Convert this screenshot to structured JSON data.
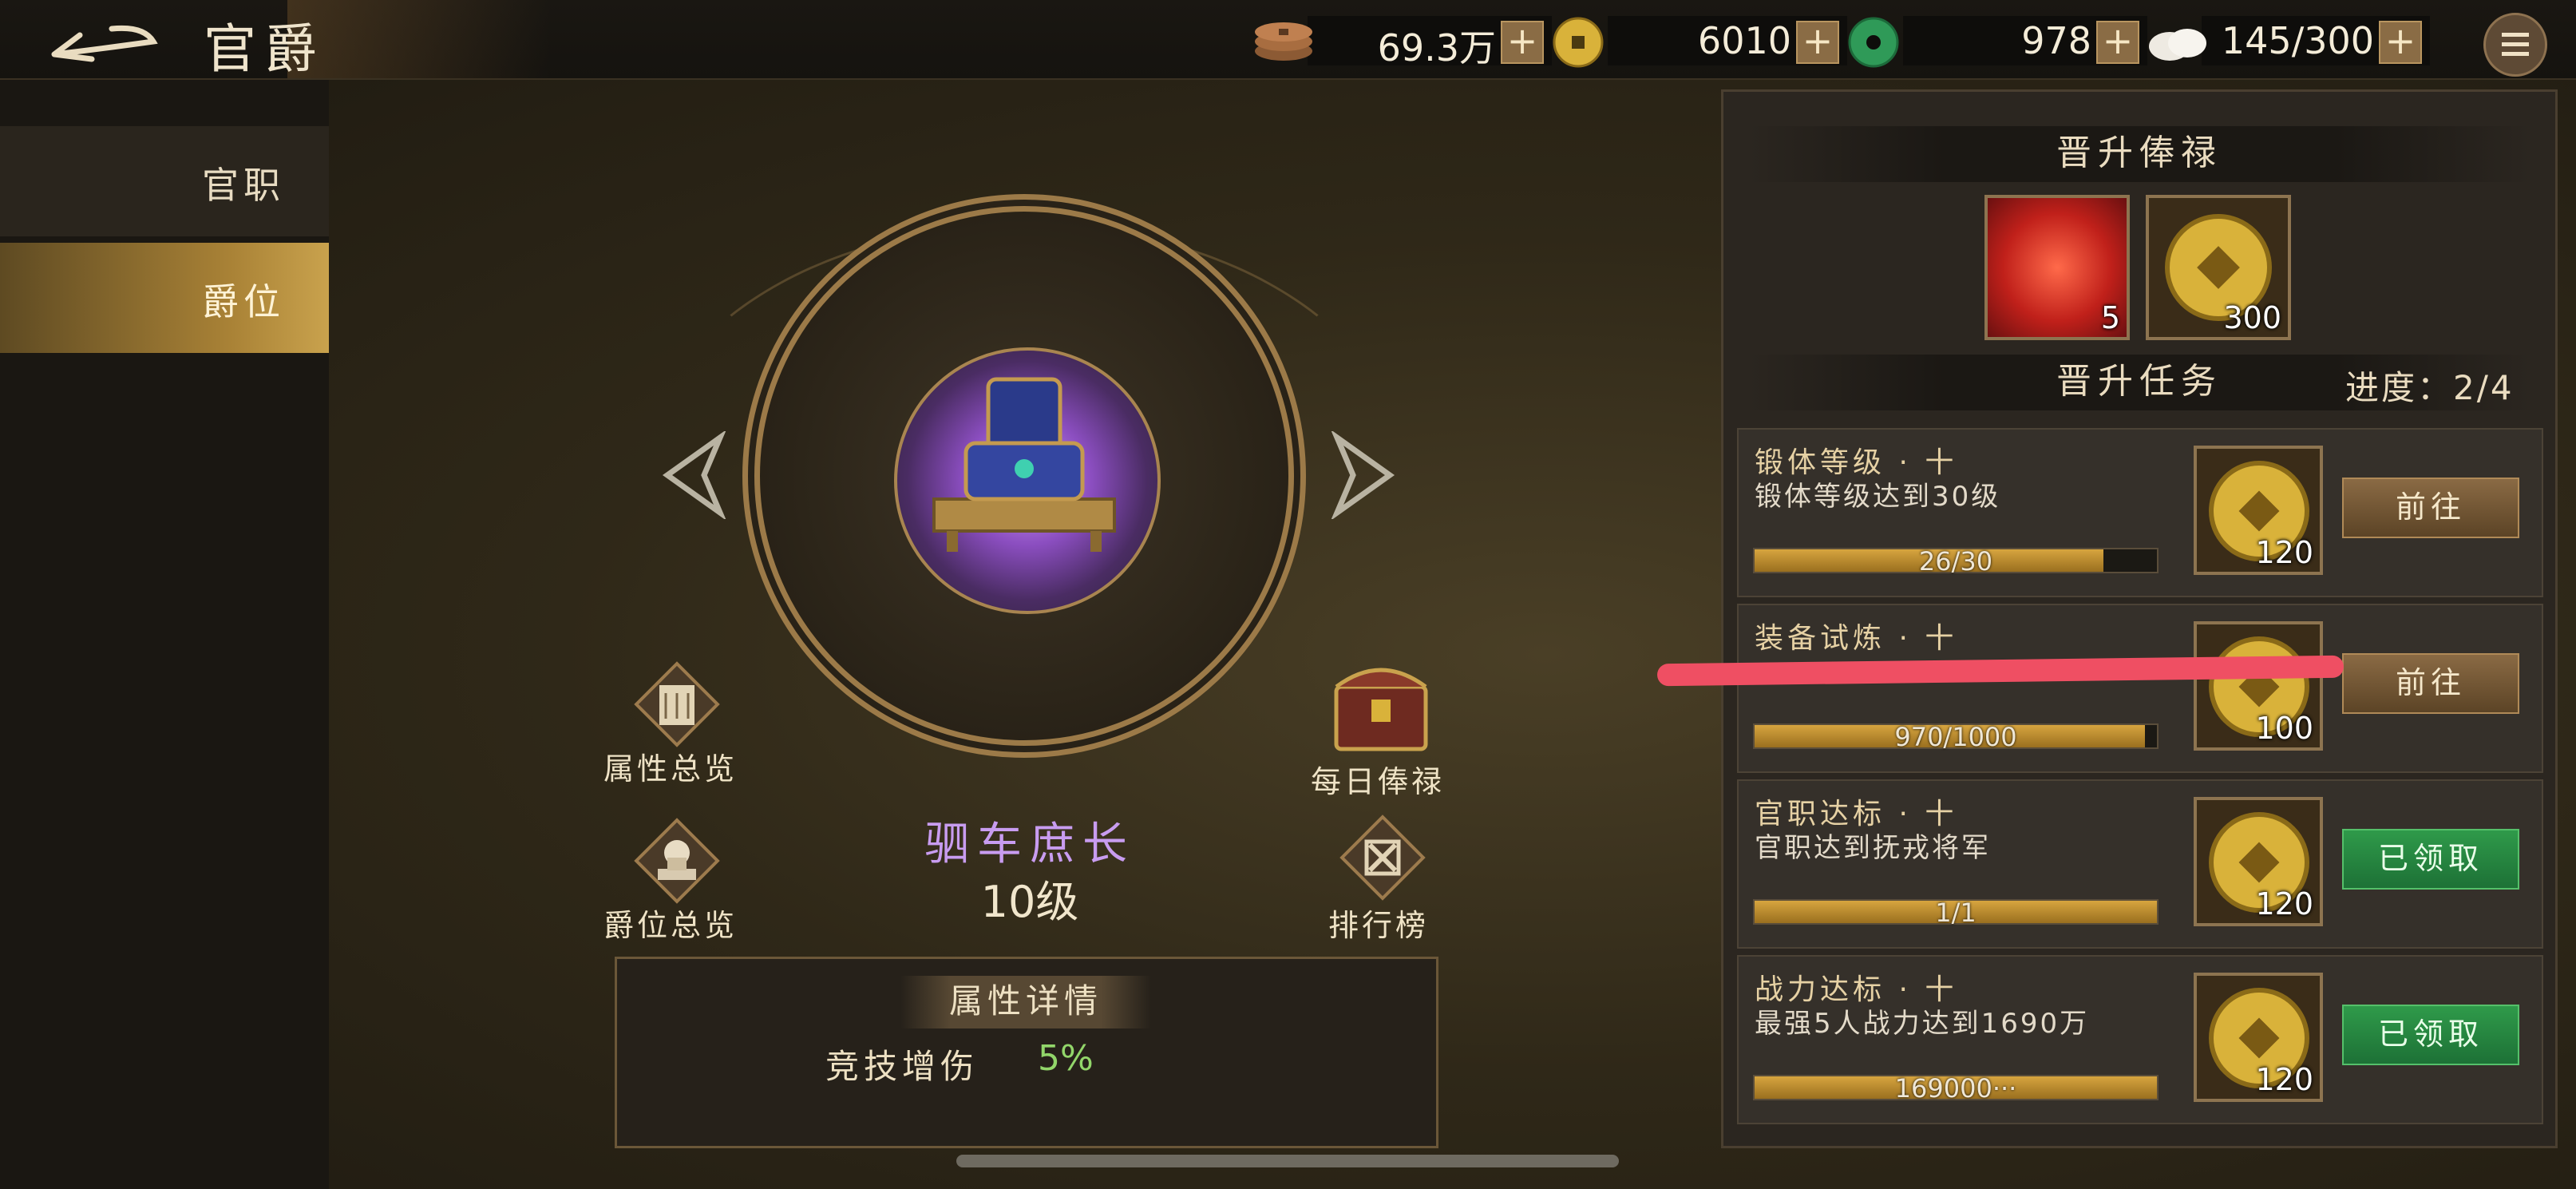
{
  "header": {
    "title": "官爵",
    "back_icon": "back-arrow-icon",
    "menu_icon": "menu-list-icon",
    "resources": [
      {
        "icon": "copper-coins-icon",
        "value": "69.3万"
      },
      {
        "icon": "gold-coin-icon",
        "value": "6010"
      },
      {
        "icon": "jade-disc-icon",
        "value": "978"
      },
      {
        "icon": "rice-bun-icon",
        "value": "145/300"
      }
    ],
    "plus_label": "+"
  },
  "sidebar": {
    "items": [
      {
        "label": "官职",
        "active": false
      },
      {
        "label": "爵位",
        "active": true
      }
    ]
  },
  "center": {
    "rank_name": "驷车庶长",
    "rank_level": "10级",
    "left_buttons": [
      {
        "label": "属性总览",
        "icon": "scroll-icon"
      },
      {
        "label": "爵位总览",
        "icon": "rank-statue-icon"
      }
    ],
    "right_buttons": [
      {
        "label": "每日俸禄",
        "icon": "treasure-chest-icon"
      },
      {
        "label": "排行榜",
        "icon": "leaderboard-icon"
      }
    ],
    "detail": {
      "title": "属性详情",
      "label": "竞技增伤",
      "value": "5%"
    }
  },
  "panel": {
    "salary_title": "晋升俸禄",
    "salary_rewards": [
      {
        "icon": "red-orb-icon",
        "count": "5"
      },
      {
        "icon": "gold-coin-icon",
        "count": "300"
      }
    ],
    "task_title": "晋升任务",
    "progress": "进度：2/4",
    "tasks": [
      {
        "name": "锻体等级 · 十",
        "desc": "锻体等级达到30级",
        "progress_text": "26/30",
        "progress": 0.867,
        "reward_count": "120",
        "button": "前往",
        "done": false
      },
      {
        "name": "装备试炼 · 十",
        "desc": "",
        "progress_text": "970/1000",
        "progress": 0.97,
        "reward_count": "100",
        "button": "前往",
        "done": false
      },
      {
        "name": "官职达标 · 十",
        "desc": "官职达到抚戎将军",
        "progress_text": "1/1",
        "progress": 1.0,
        "reward_count": "120",
        "button": "已领取",
        "done": true
      },
      {
        "name": "战力达标 · 十",
        "desc": "最强5人战力达到1690万",
        "progress_text": "169000···",
        "progress": 1.0,
        "reward_count": "120",
        "button": "已领取",
        "done": true
      }
    ]
  },
  "colors": {
    "accent_gold": "#c9a24d",
    "rank_purple": "#c89cf0",
    "value_green": "#92d66a",
    "done_green": "#2f9a4a",
    "redaction": "#ef4f63"
  }
}
